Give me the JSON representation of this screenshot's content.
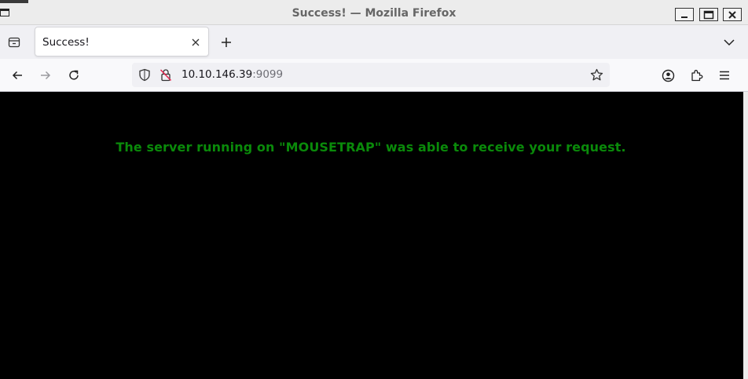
{
  "window": {
    "title": "Success! — Mozilla Firefox"
  },
  "tabs": [
    {
      "label": "Success!",
      "active": true
    }
  ],
  "address_bar": {
    "host": "10.10.146.39",
    "port": ":9099"
  },
  "page": {
    "message": "The server running on \"MOUSETRAP\" was able to receive your request.",
    "message_color": "#0a8a0a",
    "background": "#000000"
  },
  "icons": {
    "window_controls": [
      "minimize-icon",
      "maximize-icon",
      "close-icon"
    ],
    "toolbar": [
      "back-icon",
      "forward-icon",
      "reload-icon",
      "shield-icon",
      "insecure-lock-icon",
      "bookmark-star-icon",
      "account-icon",
      "extensions-icon",
      "menu-icon"
    ]
  }
}
